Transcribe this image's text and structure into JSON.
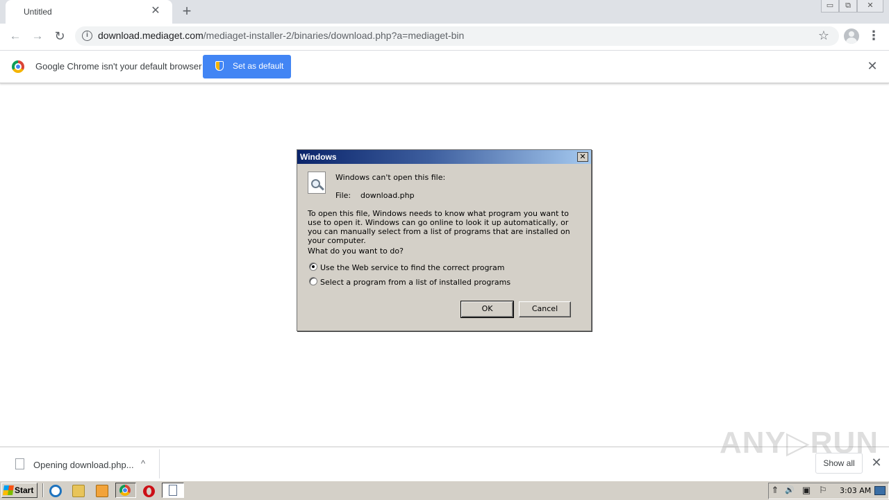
{
  "browser": {
    "tab_title": "Untitled",
    "tab_close_glyph": "✕",
    "new_tab_glyph": "+",
    "window_controls": {
      "minimize": "▭",
      "restore": "⧉",
      "close": "✕"
    },
    "url_host": "download.mediaget.com",
    "url_path": "/mediaget-installer-2/binaries/download.php?a=mediaget-bin",
    "nav": {
      "back": "←",
      "forward": "→",
      "reload": "↻"
    },
    "star_glyph": "☆",
    "menu_glyph": "⋮",
    "info_glyph": "i"
  },
  "infobar": {
    "text": "Google Chrome isn't your default browser",
    "button_label": "Set as default",
    "close_glyph": "✕"
  },
  "dialog": {
    "title": "Windows",
    "close_glyph": "✕",
    "heading": "Windows can't open this file:",
    "file_label": "File:",
    "file_name": "download.php",
    "description": "To open this file, Windows needs to know what program you want to use to open it. Windows can go online to look it up automatically, or you can manually select from a list of programs that are installed on your computer.",
    "question": "What do you want to do?",
    "options": [
      {
        "label": "Use the Web service to find the correct program",
        "selected": true
      },
      {
        "label": "Select a program from a list of installed programs",
        "selected": false
      }
    ],
    "ok_label": "OK",
    "cancel_label": "Cancel"
  },
  "download_shelf": {
    "item_text": "Opening download.php...",
    "chevron_glyph": "^",
    "show_all_label": "Show all",
    "close_glyph": "✕",
    "watermark": "ANY▷RUN"
  },
  "taskbar": {
    "start_label": "Start",
    "clock": "3:03 AM",
    "tray_icons": [
      "up-arrow-icon",
      "speaker-icon",
      "network-icon",
      "flag-icon"
    ],
    "tray_glyphs": {
      "arrow": "⇑",
      "speaker": "🔊",
      "network": "▣",
      "flag": "⚐"
    }
  }
}
